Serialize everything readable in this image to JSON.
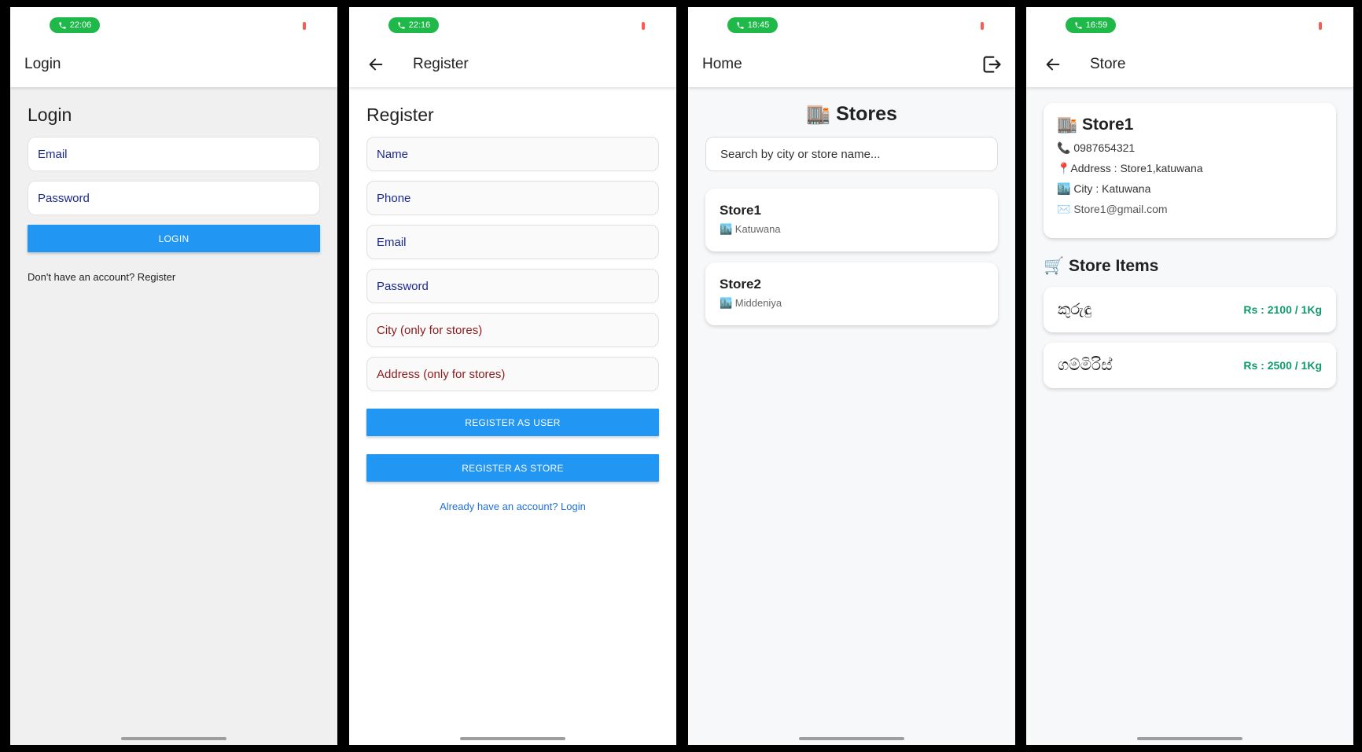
{
  "screens": {
    "login": {
      "status_time": "22:06",
      "appbar_title": "Login",
      "heading": "Login",
      "email_placeholder": "Email",
      "password_placeholder": "Password",
      "login_button": "LOGIN",
      "register_prompt": "Don't have an account? Register"
    },
    "register": {
      "status_time": "22:16",
      "appbar_title": "Register",
      "heading": "Register",
      "fields": {
        "name": "Name",
        "phone": "Phone",
        "email": "Email",
        "password": "Password",
        "city": "City (only for stores)",
        "address": "Address (only for stores)"
      },
      "register_user_button": "REGISTER AS USER",
      "register_store_button": "REGISTER AS STORE",
      "login_prompt": "Already have an account? Login"
    },
    "home": {
      "status_time": "18:45",
      "appbar_title": "Home",
      "stores_title": "🏬 Stores",
      "search_placeholder": "Search by city or store name...",
      "stores": [
        {
          "name": "Store1",
          "city": "🏙️ Katuwana"
        },
        {
          "name": "Store2",
          "city": "🏙️ Middeniya"
        }
      ]
    },
    "store": {
      "status_time": "16:59",
      "appbar_title": "Store",
      "name": "🏬 Store1",
      "phone": "📞 0987654321",
      "address": "📍Address : Store1,katuwana",
      "city": "🏙️ City : Katuwana",
      "email": "✉️ Store1@gmail.com",
      "items_title": "🛒 Store Items",
      "items": [
        {
          "name": "කුරුඳු",
          "price": "Rs : 2100 / 1Kg"
        },
        {
          "name": "ගම්මිරිස්",
          "price": "Rs : 2500 / 1Kg"
        }
      ]
    }
  },
  "colors": {
    "primary_button": "#2196f3",
    "call_pill": "#1fb94a",
    "price_green": "#0f9a6b",
    "field_text_blue": "#1a2a8c",
    "field_text_red": "#8b1a1a",
    "link_blue": "#1e6fd6"
  },
  "icons": {
    "back": "arrow-left-icon",
    "logout": "logout-icon",
    "call": "phone-icon"
  }
}
